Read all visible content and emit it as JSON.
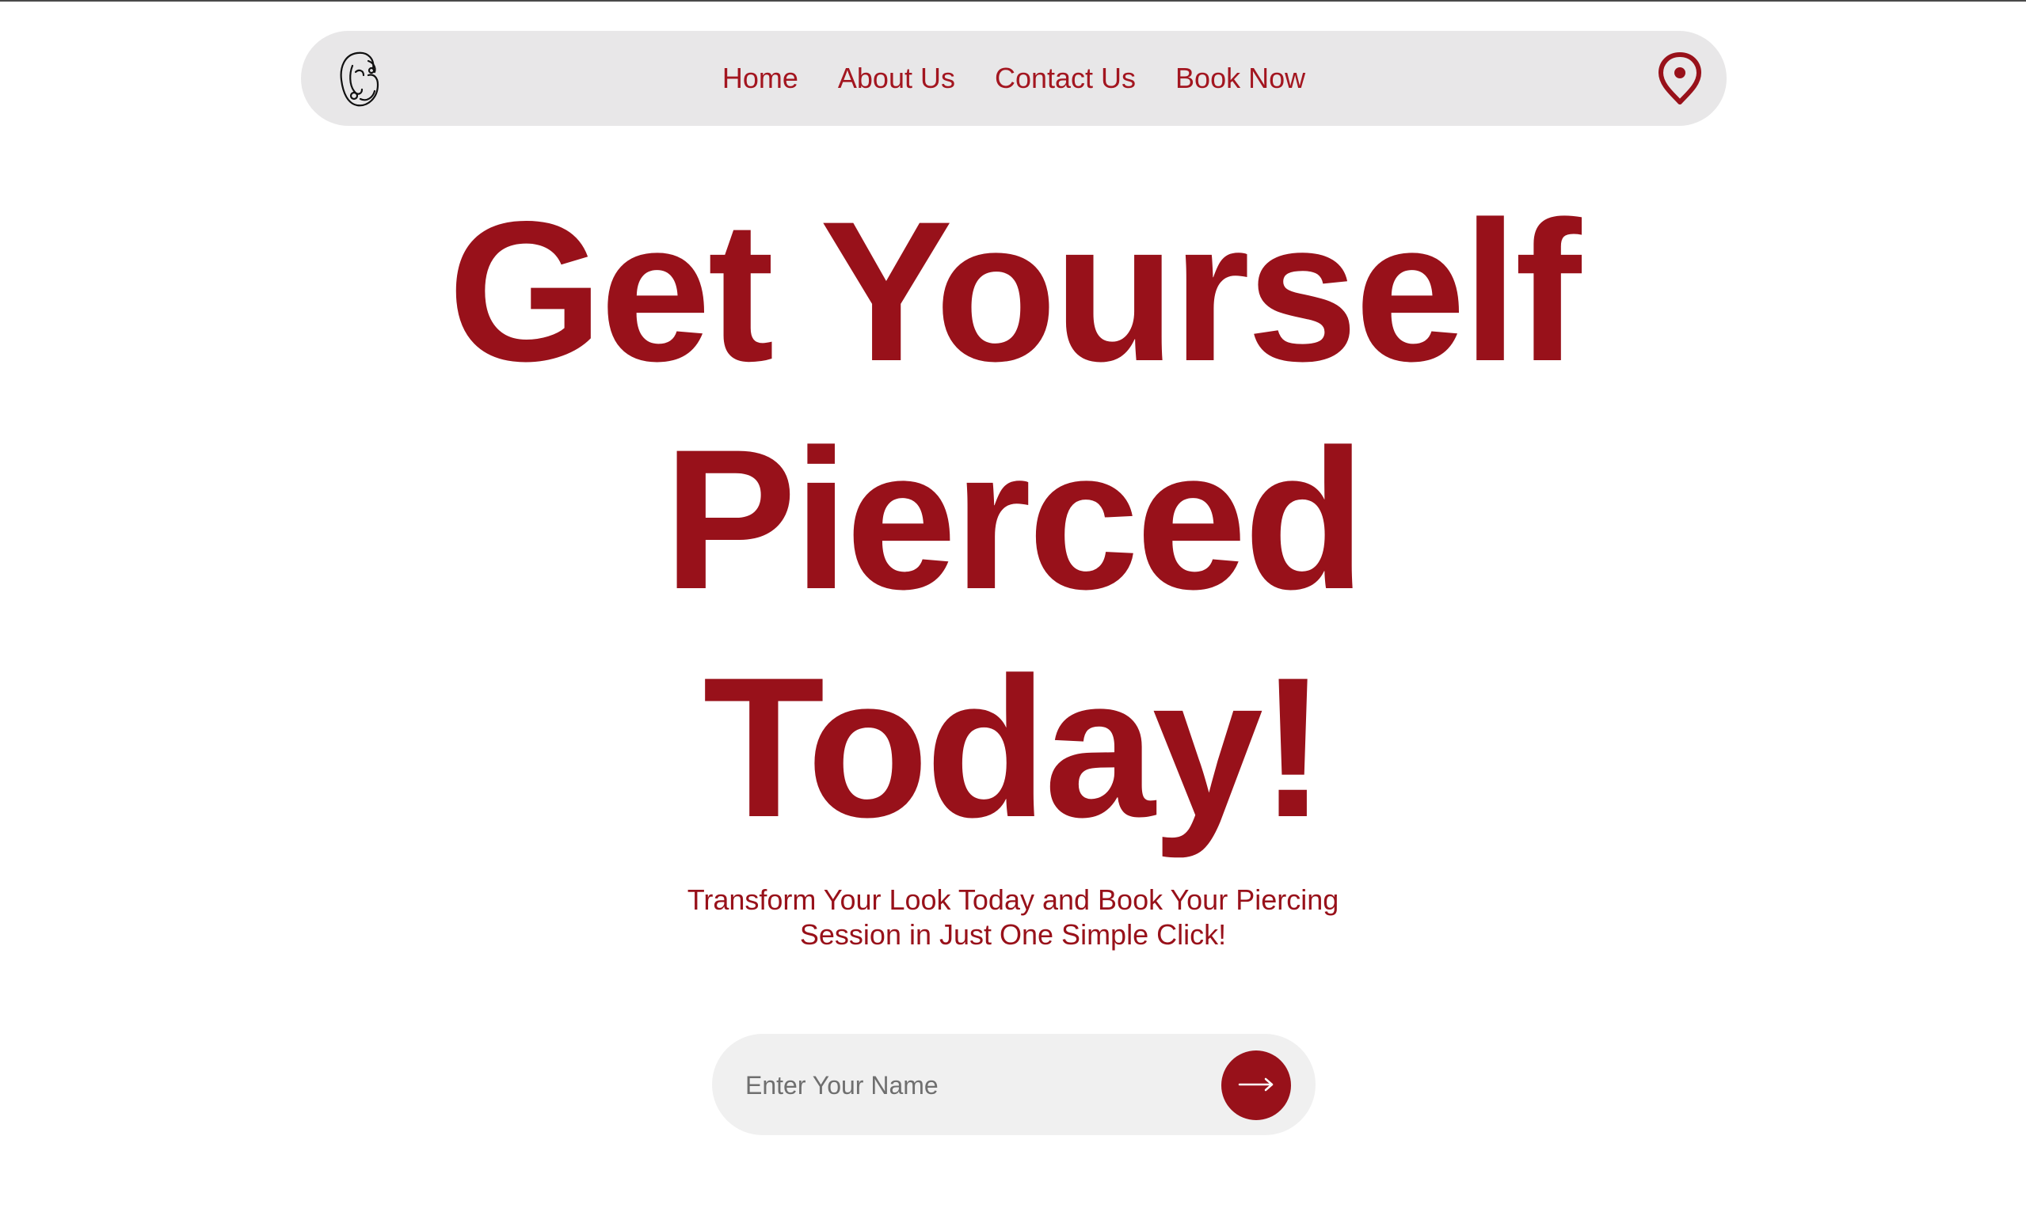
{
  "nav": {
    "logo_icon": "ear-piercing-logo-icon",
    "links": [
      {
        "label": "Home"
      },
      {
        "label": "About Us"
      },
      {
        "label": "Contact Us"
      },
      {
        "label": "Book Now"
      }
    ],
    "location_icon": "location-pin-icon"
  },
  "hero": {
    "title_line_1": "Get Yourself",
    "title_line_2": "Pierced",
    "title_line_3": "Today!",
    "subtitle_line_1": "Transform Your Look Today and Book Your Piercing",
    "subtitle_line_2": "Session in Just One Simple Click!"
  },
  "form": {
    "name_placeholder": "Enter Your Name",
    "name_value": "",
    "submit_icon": "arrow-right-icon"
  },
  "colors": {
    "accent": "#98111a",
    "nav_background": "#e8e7e8",
    "input_background": "#f0f0f0"
  }
}
